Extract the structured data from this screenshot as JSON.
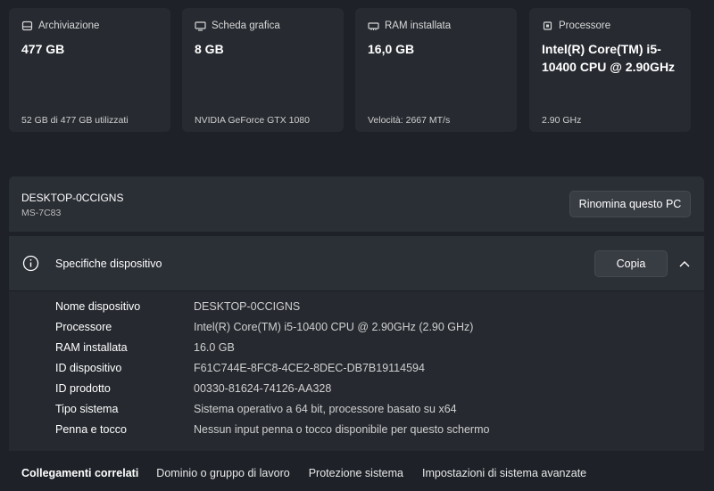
{
  "cards": [
    {
      "icon": "storage-icon",
      "label": "Archiviazione",
      "value": "477 GB",
      "sub": "52 GB di 477 GB utilizzati"
    },
    {
      "icon": "gpu-icon",
      "label": "Scheda grafica",
      "value": "8 GB",
      "sub": "NVIDIA GeForce GTX 1080"
    },
    {
      "icon": "ram-icon",
      "label": "RAM installata",
      "value": "16,0 GB",
      "sub": "Velocità: 2667 MT/s"
    },
    {
      "icon": "cpu-icon",
      "label": "Processore",
      "value": "Intel(R) Core(TM) i5-10400 CPU @ 2.90GHz",
      "sub": "2.90 GHz"
    }
  ],
  "pc": {
    "name": "DESKTOP-0CCIGNS",
    "model": "MS-7C83",
    "rename_label": "Rinomina questo PC"
  },
  "specs": {
    "title": "Specifiche dispositivo",
    "copy_label": "Copia",
    "rows": [
      {
        "key": "Nome dispositivo",
        "value": "DESKTOP-0CCIGNS"
      },
      {
        "key": "Processore",
        "value": "Intel(R) Core(TM) i5-10400 CPU @ 2.90GHz (2.90 GHz)"
      },
      {
        "key": "RAM installata",
        "value": "16.0 GB"
      },
      {
        "key": "ID dispositivo",
        "value": "F61C744E-8FC8-4CE2-8DEC-DB7B19114594"
      },
      {
        "key": "ID prodotto",
        "value": "00330-81624-74126-AA328"
      },
      {
        "key": "Tipo sistema",
        "value": "Sistema operativo a 64 bit, processore basato su x64"
      },
      {
        "key": "Penna e tocco",
        "value": "Nessun input penna o tocco disponibile per questo schermo"
      }
    ]
  },
  "related": {
    "title": "Collegamenti correlati",
    "links": [
      "Dominio o gruppo di lavoro",
      "Protezione sistema",
      "Impostazioni di sistema avanzate"
    ]
  }
}
